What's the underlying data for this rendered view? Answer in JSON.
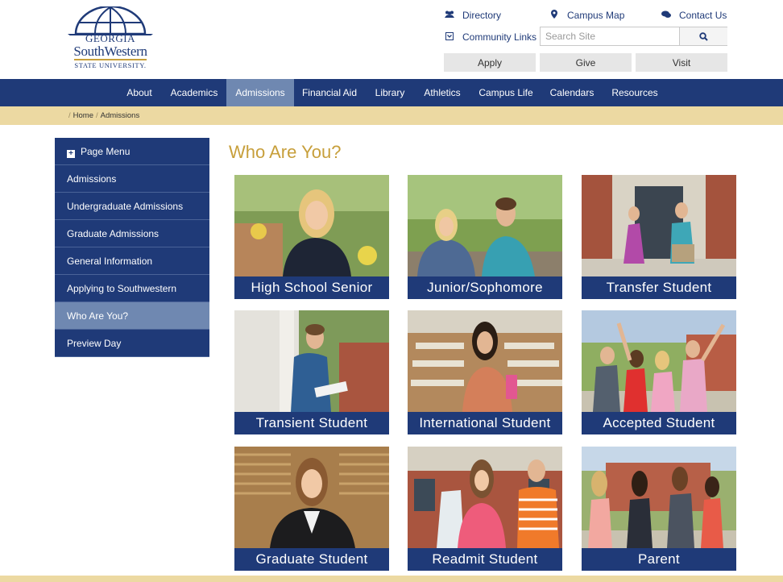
{
  "logo": {
    "line1": "GEORGIA",
    "line2": "SouthWestern",
    "line3": "STATE UNIVERSITY."
  },
  "utility": {
    "directory": "Directory",
    "campus_map": "Campus Map",
    "contact": "Contact Us",
    "community_links": "Community Links",
    "search_placeholder": "Search Site",
    "apply": "Apply",
    "give": "Give",
    "visit": "Visit"
  },
  "nav": {
    "items": [
      "About",
      "Academics",
      "Admissions",
      "Financial Aid",
      "Library",
      "Athletics",
      "Campus Life",
      "Calendars",
      "Resources"
    ],
    "active": "Admissions"
  },
  "breadcrumb": {
    "home": "Home",
    "current": "Admissions"
  },
  "sidebar": {
    "header": "Page Menu",
    "items": [
      "Admissions",
      "Undergraduate Admissions",
      "Graduate Admissions",
      "General Information",
      "Applying to Southwestern",
      "Who Are You?",
      "Preview Day"
    ],
    "active": "Who Are You?"
  },
  "main": {
    "title": "Who Are You?",
    "tiles": [
      "High School Senior",
      "Junior/Sophomore",
      "Transfer Student",
      "Transient Student",
      "International Student",
      "Accepted Student",
      "Graduate Student",
      "Readmit Student",
      "Parent"
    ]
  },
  "colors": {
    "navy": "#1f3a78",
    "gold": "#c79f3b",
    "tan": "#ecd9a2",
    "active_blue": "#6f88b1"
  }
}
